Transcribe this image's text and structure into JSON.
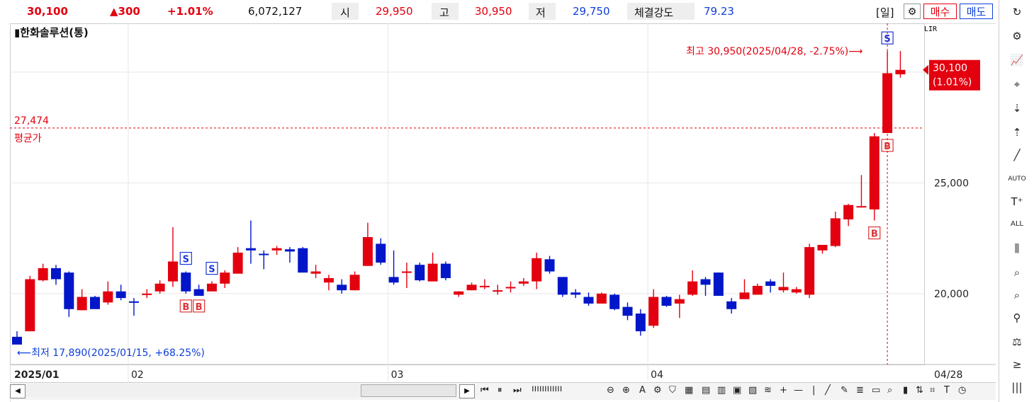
{
  "quote": {
    "price": "30,100",
    "change": "▲300",
    "change_pct": "+1.01%",
    "volume": "6,072,127",
    "open_label": "시",
    "open": "29,950",
    "high_label": "고",
    "high": "30,950",
    "low_label": "저",
    "low": "29,750",
    "strength_label": "체결강도",
    "strength": "79.23"
  },
  "controls": {
    "period": "[일]",
    "buy": "매수",
    "sell": "매도",
    "lir": "LIR"
  },
  "chart": {
    "stock_name": "한화솔루션(통)",
    "max_annotation": "최고 30,950(2025/04/28, -2.75%)",
    "min_annotation": "최저 17,890(2025/01/15, +68.25%)",
    "avg_value": "27,474",
    "avg_label": "평균가",
    "current_price": "30,100",
    "current_pct": "(1.01%)"
  },
  "chart_data": {
    "type": "candlestick",
    "y_ticks": [
      "25,000",
      "20,000"
    ],
    "x_ticks": [
      "2025/01",
      "02",
      "03",
      "04",
      "04/28"
    ],
    "ylim": [
      16800,
      32200
    ],
    "avg_price": 27474,
    "candles": [
      {
        "o": 18050,
        "h": 18300,
        "l": 17890,
        "c": 17700
      },
      {
        "o": 18300,
        "h": 20800,
        "l": 18300,
        "c": 20650
      },
      {
        "o": 20600,
        "h": 21350,
        "l": 20550,
        "c": 21150
      },
      {
        "o": 21150,
        "h": 21300,
        "l": 20400,
        "c": 20650
      },
      {
        "o": 20950,
        "h": 21000,
        "l": 18950,
        "c": 19300
      },
      {
        "o": 19250,
        "h": 20200,
        "l": 19250,
        "c": 19850
      },
      {
        "o": 19850,
        "h": 19900,
        "l": 19350,
        "c": 19300
      },
      {
        "o": 19600,
        "h": 20550,
        "l": 19500,
        "c": 20100
      },
      {
        "o": 20100,
        "h": 20400,
        "l": 19700,
        "c": 19800
      },
      {
        "o": 19650,
        "h": 19800,
        "l": 19000,
        "c": 19600
      },
      {
        "o": 19950,
        "h": 20200,
        "l": 19800,
        "c": 20000
      },
      {
        "o": 20100,
        "h": 20600,
        "l": 20000,
        "c": 20450
      },
      {
        "o": 20550,
        "h": 23000,
        "l": 20300,
        "c": 21450
      },
      {
        "o": 20950,
        "h": 21000,
        "l": 20000,
        "c": 20100
      },
      {
        "o": 20200,
        "h": 20400,
        "l": 20000,
        "c": 19900
      },
      {
        "o": 20100,
        "h": 20550,
        "l": 20100,
        "c": 20450
      },
      {
        "o": 20450,
        "h": 21050,
        "l": 20250,
        "c": 20950
      },
      {
        "o": 20900,
        "h": 22100,
        "l": 20900,
        "c": 21850
      },
      {
        "o": 22050,
        "h": 23300,
        "l": 21350,
        "c": 21950
      },
      {
        "o": 21800,
        "h": 21950,
        "l": 21100,
        "c": 21750
      },
      {
        "o": 21950,
        "h": 22150,
        "l": 21750,
        "c": 22050
      },
      {
        "o": 22000,
        "h": 22100,
        "l": 21400,
        "c": 21900
      },
      {
        "o": 22050,
        "h": 22100,
        "l": 20950,
        "c": 20950
      },
      {
        "o": 20900,
        "h": 21300,
        "l": 20700,
        "c": 21000
      },
      {
        "o": 20500,
        "h": 20850,
        "l": 20150,
        "c": 20700
      },
      {
        "o": 20400,
        "h": 20650,
        "l": 20000,
        "c": 20150
      },
      {
        "o": 20150,
        "h": 21000,
        "l": 20150,
        "c": 20850
      },
      {
        "o": 21250,
        "h": 23200,
        "l": 21250,
        "c": 22550
      },
      {
        "o": 22250,
        "h": 22500,
        "l": 21300,
        "c": 21400
      },
      {
        "o": 20750,
        "h": 21950,
        "l": 20400,
        "c": 20500
      },
      {
        "o": 20950,
        "h": 21400,
        "l": 20250,
        "c": 21000
      },
      {
        "o": 21300,
        "h": 21400,
        "l": 20550,
        "c": 20600
      },
      {
        "o": 20550,
        "h": 21850,
        "l": 20550,
        "c": 21350
      },
      {
        "o": 21350,
        "h": 21450,
        "l": 20600,
        "c": 20700
      },
      {
        "o": 19950,
        "h": 20100,
        "l": 19850,
        "c": 20100
      },
      {
        "o": 20150,
        "h": 20500,
        "l": 20150,
        "c": 20400
      },
      {
        "o": 20350,
        "h": 20650,
        "l": 20200,
        "c": 20350
      },
      {
        "o": 20150,
        "h": 20400,
        "l": 19950,
        "c": 20150
      },
      {
        "o": 20250,
        "h": 20550,
        "l": 20050,
        "c": 20300
      },
      {
        "o": 20450,
        "h": 20700,
        "l": 20350,
        "c": 20550
      },
      {
        "o": 20550,
        "h": 21850,
        "l": 20200,
        "c": 21600
      },
      {
        "o": 21550,
        "h": 21700,
        "l": 20900,
        "c": 21000
      },
      {
        "o": 20750,
        "h": 20750,
        "l": 19850,
        "c": 19950
      },
      {
        "o": 20050,
        "h": 20200,
        "l": 19800,
        "c": 19950
      },
      {
        "o": 19850,
        "h": 20050,
        "l": 19450,
        "c": 19550
      },
      {
        "o": 19550,
        "h": 20050,
        "l": 19550,
        "c": 20000
      },
      {
        "o": 19950,
        "h": 20000,
        "l": 19250,
        "c": 19300
      },
      {
        "o": 19400,
        "h": 19600,
        "l": 18800,
        "c": 19000
      },
      {
        "o": 19100,
        "h": 19300,
        "l": 18100,
        "c": 18300
      },
      {
        "o": 18550,
        "h": 20200,
        "l": 18450,
        "c": 19850
      },
      {
        "o": 19850,
        "h": 19900,
        "l": 19400,
        "c": 19450
      },
      {
        "o": 19550,
        "h": 19950,
        "l": 18900,
        "c": 19750
      },
      {
        "o": 19950,
        "h": 21050,
        "l": 19900,
        "c": 20550
      },
      {
        "o": 20650,
        "h": 20750,
        "l": 19900,
        "c": 20400
      },
      {
        "o": 20950,
        "h": 20950,
        "l": 19900,
        "c": 19900
      },
      {
        "o": 19650,
        "h": 19800,
        "l": 19100,
        "c": 19300
      },
      {
        "o": 19750,
        "h": 20650,
        "l": 19750,
        "c": 20050
      },
      {
        "o": 19950,
        "h": 20450,
        "l": 19950,
        "c": 20350
      },
      {
        "o": 20550,
        "h": 20650,
        "l": 20050,
        "c": 20350
      },
      {
        "o": 20150,
        "h": 20950,
        "l": 20050,
        "c": 20300
      },
      {
        "o": 20050,
        "h": 20300,
        "l": 20000,
        "c": 20200
      },
      {
        "o": 19950,
        "h": 22250,
        "l": 19800,
        "c": 22100
      },
      {
        "o": 21950,
        "h": 22200,
        "l": 21800,
        "c": 22200
      },
      {
        "o": 22150,
        "h": 23700,
        "l": 22100,
        "c": 23400
      },
      {
        "o": 23350,
        "h": 24050,
        "l": 23050,
        "c": 24000
      },
      {
        "o": 23950,
        "h": 25350,
        "l": 23950,
        "c": 23950
      },
      {
        "o": 23800,
        "h": 27250,
        "l": 23300,
        "c": 27100
      },
      {
        "o": 27250,
        "h": 30950,
        "l": 27250,
        "c": 29950
      },
      {
        "o": 29900,
        "h": 30950,
        "l": 29750,
        "c": 30100
      }
    ],
    "signals": [
      {
        "type": "S",
        "i": 13
      },
      {
        "type": "B",
        "i": 13
      },
      {
        "type": "B",
        "i": 14
      },
      {
        "type": "S",
        "i": 15
      },
      {
        "type": "B",
        "i": 66
      },
      {
        "type": "S",
        "i": 67
      },
      {
        "type": "B",
        "i": 67
      }
    ]
  }
}
